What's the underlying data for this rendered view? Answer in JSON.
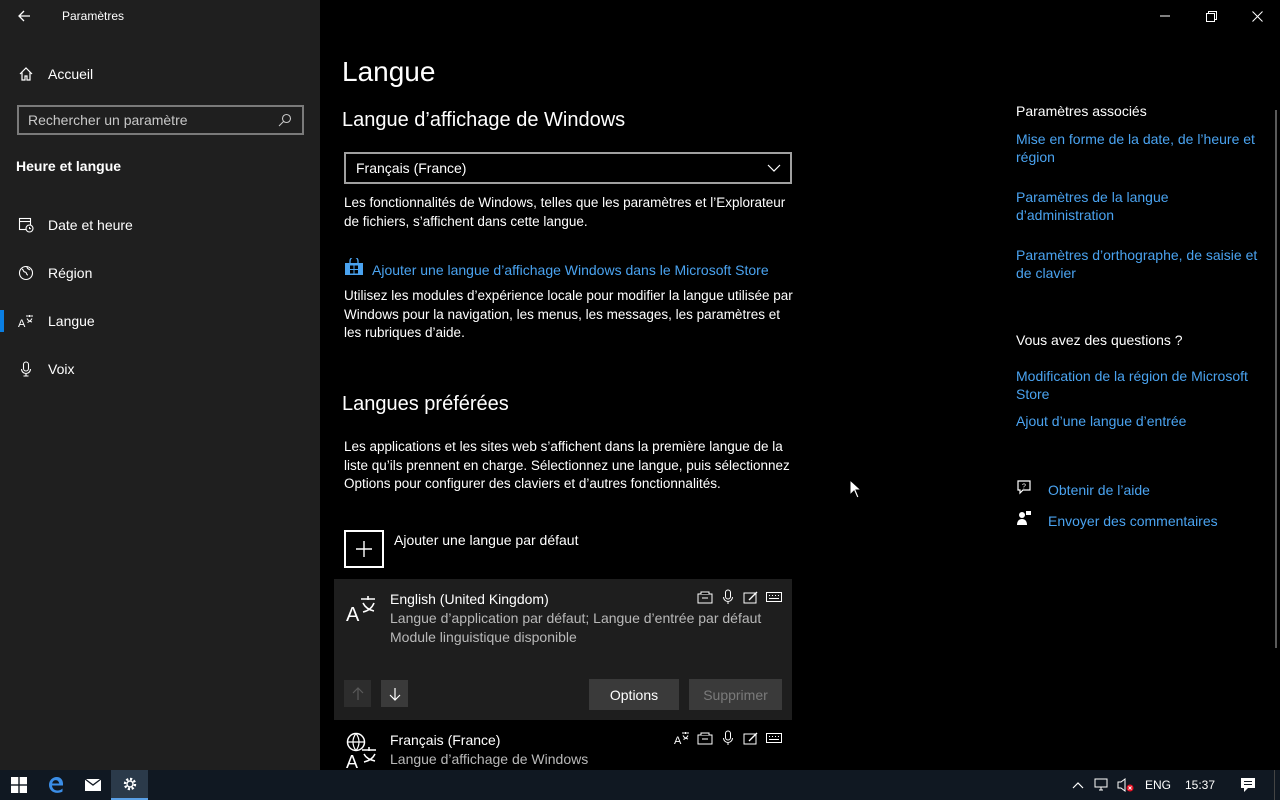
{
  "window": {
    "app_title": "Paramètres",
    "back_icon": "back-arrow-icon",
    "controls": [
      "minimize-icon",
      "restore-icon",
      "close-icon"
    ]
  },
  "sidebar": {
    "home_label": "Accueil",
    "search_placeholder": "Rechercher un paramètre",
    "section_title": "Heure et langue",
    "items": [
      {
        "label": "Date et heure",
        "icon": "date-time-icon",
        "selected": false
      },
      {
        "label": "Région",
        "icon": "region-globe-icon",
        "selected": false
      },
      {
        "label": "Langue",
        "icon": "language-icon",
        "selected": true
      },
      {
        "label": "Voix",
        "icon": "microphone-icon",
        "selected": false
      }
    ]
  },
  "main": {
    "page_title": "Langue",
    "display_lang": {
      "heading": "Langue d’affichage de Windows",
      "dropdown_value": "Français (France)",
      "desc": "Les fonctionnalités de Windows, telles que les paramètres et l’Explorateur de fichiers, s’affichent dans cette langue.",
      "store_link": "Ajouter une langue d’affichage Windows dans le Microsoft Store",
      "store_desc": "Utilisez les modules d’expérience locale pour modifier la langue utilisée par Windows pour la navigation, les menus, les messages, les paramètres et les rubriques d’aide."
    },
    "preferred": {
      "heading": "Langues préférées",
      "desc": "Les applications et les sites web s’affichent dans la première langue de la liste qu’ils prennent en charge. Sélectionnez une langue, puis sélectionnez Options pour configurer des claviers et d’autres fonctionnalités.",
      "add_label": "Ajouter une langue par défaut",
      "languages": [
        {
          "name": "English (United Kingdom)",
          "line1": "Langue d’application par défaut; Langue d’entrée par défaut",
          "line2": "Module linguistique disponible",
          "options_label": "Options",
          "remove_label": "Supprimer"
        },
        {
          "name": "Français (France)",
          "line1": "Langue d’affichage de Windows"
        }
      ]
    }
  },
  "related": {
    "heading": "Paramètres associés",
    "links": [
      "Mise en forme de la date, de l’heure et région",
      "Paramètres de la langue d’administration",
      "Paramètres d’orthographe, de saisie et de clavier"
    ],
    "questions_heading": "Vous avez des questions ?",
    "question_links": [
      "Modification de la région de Microsoft Store",
      "Ajout d’une langue d’entrée"
    ],
    "help": "Obtenir de l’aide",
    "feedback": "Envoyer des commentaires"
  },
  "taskbar": {
    "lang": "ENG",
    "time": "15:37"
  },
  "colors": {
    "accent": "#0a7ee2",
    "link": "#4aa3f0",
    "sidebar_bg": "#1f1f1f",
    "content_bg": "#000000"
  }
}
